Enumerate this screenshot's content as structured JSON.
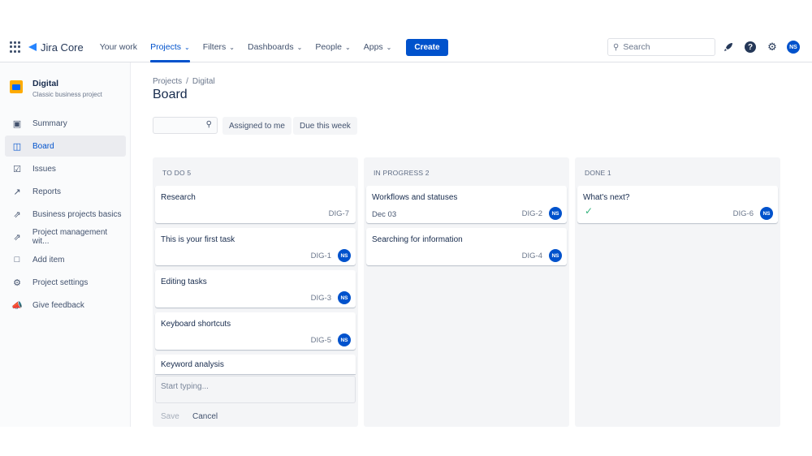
{
  "app": {
    "logo_text": "Jira Core"
  },
  "nav": {
    "your_work": "Your work",
    "projects": "Projects",
    "filters": "Filters",
    "dashboards": "Dashboards",
    "people": "People",
    "apps": "Apps",
    "create": "Create"
  },
  "search": {
    "placeholder": "Search"
  },
  "user": {
    "initials": "NS"
  },
  "project": {
    "name": "Digital",
    "type": "Classic business project"
  },
  "sidebar": {
    "items": [
      {
        "label": "Summary",
        "icon": "summary-icon"
      },
      {
        "label": "Board",
        "icon": "board-icon"
      },
      {
        "label": "Issues",
        "icon": "issues-icon"
      },
      {
        "label": "Reports",
        "icon": "reports-icon"
      },
      {
        "label": "Business projects basics",
        "icon": "external-link-icon"
      },
      {
        "label": "Project management wit...",
        "icon": "external-link-icon"
      },
      {
        "label": "Add item",
        "icon": "add-item-icon"
      },
      {
        "label": "Project settings",
        "icon": "gear-icon"
      },
      {
        "label": "Give feedback",
        "icon": "megaphone-icon"
      }
    ]
  },
  "breadcrumb": {
    "root": "Projects",
    "sep": "/",
    "current": "Digital"
  },
  "page_title": "Board",
  "filters": {
    "assigned": "Assigned to me",
    "due": "Due this week"
  },
  "columns": [
    {
      "title": "TO DO 5",
      "cards": [
        {
          "title": "Research",
          "key": "DIG-7"
        },
        {
          "title": "This is your first task",
          "key": "DIG-1",
          "assignee": "NS"
        },
        {
          "title": "Editing tasks",
          "key": "DIG-3",
          "assignee": "NS"
        },
        {
          "title": "Keyboard shortcuts",
          "key": "DIG-5",
          "assignee": "NS"
        },
        {
          "title": "Keyword analysis"
        }
      ],
      "compose_placeholder": "Start typing...",
      "save": "Save",
      "cancel": "Cancel"
    },
    {
      "title": "IN PROGRESS 2",
      "cards": [
        {
          "title": "Workflows and statuses",
          "date": "Dec 03",
          "key": "DIG-2",
          "assignee": "NS"
        },
        {
          "title": "Searching for information",
          "key": "DIG-4",
          "assignee": "NS"
        }
      ]
    },
    {
      "title": "DONE 1",
      "cards": [
        {
          "title": "What's next?",
          "key": "DIG-6",
          "assignee": "NS"
        }
      ]
    }
  ],
  "colors": {
    "brand": "#0052cc",
    "done_check": "#36b37e"
  }
}
